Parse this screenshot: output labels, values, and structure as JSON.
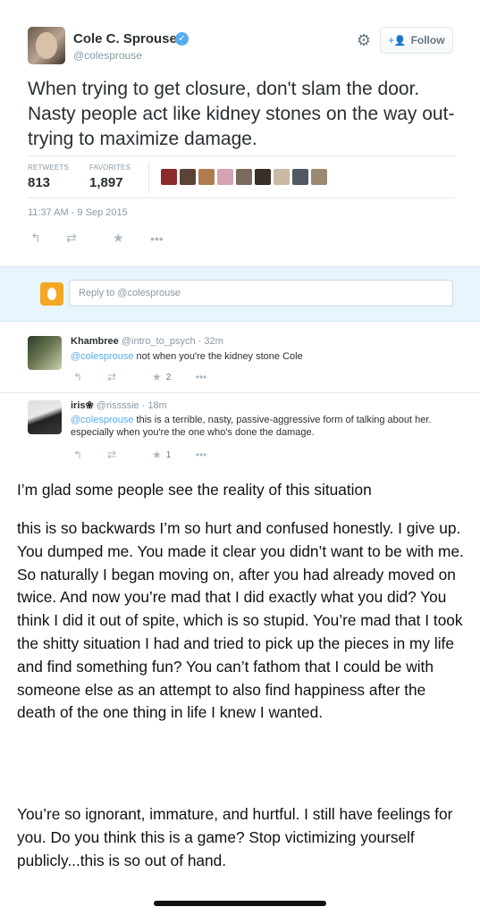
{
  "tweet": {
    "author_name": "Cole C. Sprouse",
    "verified_icon": "verified-badge-icon",
    "handle": "@colesprouse",
    "settings_icon": "gear-icon",
    "follow_label": "Follow",
    "follow_icon": "add-person-icon",
    "text": "When trying to get closure, don't slam the door. Nasty people act like kidney stones on the way out-trying to maximize damage.",
    "retweets_label": "RETWEETS",
    "retweets_count": "813",
    "favorites_label": "FAVORITES",
    "favorites_count": "1,897",
    "timestamp": "11:37 AM - 9 Sep 2015",
    "actions": [
      "reply-icon",
      "retweet-icon",
      "favorite-star-icon",
      "more-icon"
    ]
  },
  "reply_box": {
    "placeholder": "Reply to @colesprouse"
  },
  "replies": [
    {
      "name": "Khambree",
      "handle": "@intro_to_psych",
      "time": "· 32m",
      "mention": "@colesprouse",
      "text": " not when you're the kidney stone Cole",
      "favorites": "2"
    },
    {
      "name": "iris❀",
      "handle": "@rissssie",
      "time": "· 18m",
      "mention": "@colesprouse",
      "text": " this is a terrible, nasty, passive-aggressive form of talking about her. especially when you're the one who's done the damage.",
      "favorites": "1"
    }
  ],
  "caption": {
    "line1": "I’m glad some people see the reality of this situation",
    "para1": "this is so backwards I’m so hurt and confused honestly. I give up. You dumped me. You made it clear you didn’t want to be with me. So naturally I began moving on, after you had already moved on twice. And now you’re mad that I did exactly what you did? You think I did it out of spite, which is so stupid. You’re mad that I took the shitty situation I had and tried to pick up the pieces in my life and find something fun? You can’t fathom that I could be with someone else as an attempt to also find happiness after the death of the one thing in life I knew I wanted.",
    "para2": "You’re so ignorant, immature, and hurtful. I still have feelings for you. Do you think this is a game? Stop victimizing yourself publicly...this is so out of hand."
  },
  "colors": {
    "link_blue": "#55acee",
    "muted_gray": "#8899a6",
    "reply_bg": "#e8f5fd"
  }
}
